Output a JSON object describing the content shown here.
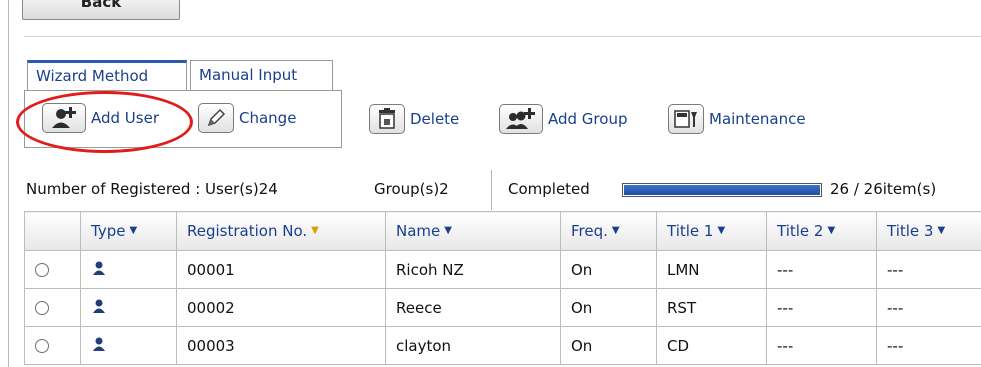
{
  "header": {
    "back_label": "Back"
  },
  "tabs": [
    {
      "label": "Wizard Method",
      "active": true
    },
    {
      "label": "Manual Input",
      "active": false
    }
  ],
  "toolbar": {
    "add_user": "Add User",
    "change": "Change",
    "delete": "Delete",
    "add_group": "Add Group",
    "maintenance": "Maintenance"
  },
  "icons": {
    "add_user": "add-user-icon",
    "change": "pencil-icon",
    "delete": "trash-icon",
    "add_group": "add-group-icon",
    "maintenance": "maintenance-icon",
    "user_type": "user-icon"
  },
  "status": {
    "registered": "Number of Registered : User(s)24",
    "groups": "Group(s)2",
    "completed": "Completed",
    "progress_fraction": 1.0,
    "count": "26 / 26item(s)"
  },
  "colors": {
    "accent": "#1a3f8f",
    "highlight": "#e21b1b",
    "progress": "#1f4f9f",
    "active_sort": "#d8a000"
  },
  "table": {
    "columns": [
      {
        "label": "",
        "sortable": false
      },
      {
        "label": "Type",
        "sortable": true
      },
      {
        "label": "Registration No.",
        "sortable": true,
        "active": true
      },
      {
        "label": "Name",
        "sortable": true
      },
      {
        "label": "Freq.",
        "sortable": true
      },
      {
        "label": "Title 1",
        "sortable": true
      },
      {
        "label": "Title 2",
        "sortable": true
      },
      {
        "label": "Title 3",
        "sortable": true
      }
    ],
    "rows": [
      {
        "reg_no": "00001",
        "name": "Ricoh NZ",
        "freq": "On",
        "title1": "LMN",
        "title2": "---",
        "title3": "---"
      },
      {
        "reg_no": "00002",
        "name": "Reece",
        "freq": "On",
        "title1": "RST",
        "title2": "---",
        "title3": "---"
      },
      {
        "reg_no": "00003",
        "name": "clayton",
        "freq": "On",
        "title1": "CD",
        "title2": "---",
        "title3": "---"
      }
    ]
  }
}
